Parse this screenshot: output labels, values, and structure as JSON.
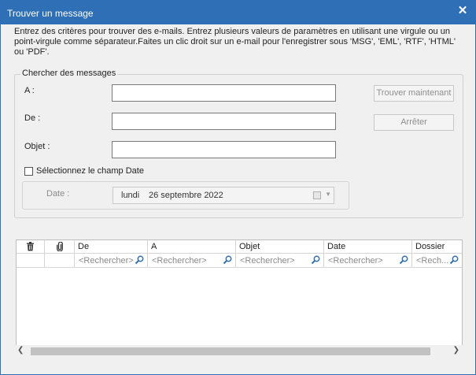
{
  "window": {
    "title": "Trouver un message",
    "close_glyph": "✕"
  },
  "intro_text": "Entrez des critères pour trouver des e-mails. Entrez plusieurs valeurs de paramètres en utilisant une virgule ou un point-virgule comme séparateur.Faites un clic droit sur un e-mail pour l'enregistrer sous 'MSG', 'EML', 'RTF', 'HTML' ou 'PDF'.",
  "search_group": {
    "legend": "Chercher des messages",
    "to_label": "A :",
    "to_value": "",
    "from_label": "De :",
    "from_value": "",
    "subject_label": "Objet :",
    "subject_value": "",
    "find_button": "Trouver maintenant",
    "stop_button": "Arrêter",
    "date_checkbox_label": "Sélectionnez le champ Date",
    "date_checkbox_checked": false,
    "date_label": "Date :",
    "date_day": "lundi",
    "date_value": "26 septembre 2022"
  },
  "results_grid": {
    "columns": [
      {
        "key": "delete",
        "label": "",
        "icon": "trash-icon"
      },
      {
        "key": "attachment",
        "label": "",
        "icon": "paperclip-icon"
      },
      {
        "key": "from",
        "label": "De"
      },
      {
        "key": "to",
        "label": "A"
      },
      {
        "key": "subject",
        "label": "Objet"
      },
      {
        "key": "date",
        "label": "Date"
      },
      {
        "key": "folder",
        "label": "Dossier"
      }
    ],
    "filter_placeholder": "<Rechercher>",
    "filter_placeholder_truncated": "<Rech...",
    "rows": []
  },
  "colors": {
    "titlebar": "#2f6fb5",
    "window_bg": "#f0f0f0",
    "disabled_text": "#8e8e8e"
  }
}
